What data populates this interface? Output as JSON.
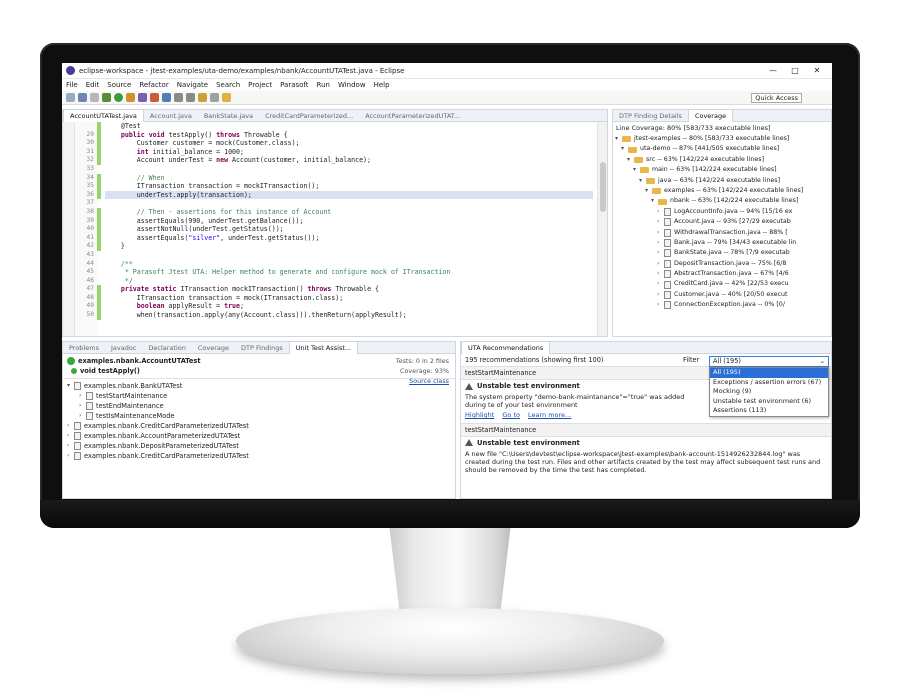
{
  "window": {
    "title": "eclipse-workspace - jtest-examples/uta-demo/examples/nbank/AccountUTATest.java - Eclipse",
    "minimize": "—",
    "maximize": "□",
    "close": "✕"
  },
  "menu": [
    "File",
    "Edit",
    "Source",
    "Refactor",
    "Navigate",
    "Search",
    "Project",
    "Parasoft",
    "Run",
    "Window",
    "Help"
  ],
  "toolbar": {
    "quick_access": "Quick Access"
  },
  "editor": {
    "tabs": [
      "AccountUTATest.java",
      "Account.java",
      "BankState.java",
      "CreditCardParameterized...",
      "AccountParameterizedUTAT..."
    ],
    "line_numbers": [
      "",
      "29",
      "30",
      "31",
      "32",
      "33",
      "34",
      "35",
      "36",
      "37",
      "38",
      "39",
      "40",
      "41",
      "42",
      "43",
      "44",
      "45",
      "46",
      "47",
      "48",
      "49",
      "50",
      "51"
    ],
    "lines": [
      "    @Test",
      "    public void testApply() throws Throwable {",
      "        Customer customer = mock(Customer.class);",
      "        int initial_balance = 1000;",
      "        Account underTest = new Account(customer, initial_balance);",
      "",
      "        // When",
      "        ITransaction transaction = mockITransaction();",
      "        underTest.apply(transaction);",
      "",
      "        // Then - assertions for this instance of Account",
      "        assertEquals(990, underTest.getBalance());",
      "        assertNotNull(underTest.getStatus());",
      "        assertEquals(\"silver\", underTest.getStatus());",
      "    }",
      "",
      "    /**",
      "     * Parasoft Jtest UTA: Helper method to generate and configure mock of ITransaction",
      "     */",
      "    private static ITransaction mockITransaction() throws Throwable {",
      "        ITransaction transaction = mock(ITransaction.class);",
      "        boolean applyResult = true;",
      "        when(transaction.apply(any(Account.class))).thenReturn(applyResult);"
    ]
  },
  "coverage": {
    "tabs": [
      "DTP Finding Details",
      "Coverage"
    ],
    "summary": "Line Coverage: 80% [583/733 executable lines]",
    "tree": [
      {
        "label": "jtest-examples -- 80% [583/733 executable lines]",
        "type": "folder",
        "level": 0
      },
      {
        "label": "uta-demo -- 87% [441/505 executable lines]",
        "type": "folder",
        "level": 1
      },
      {
        "label": "src -- 63% [142/224 executable lines]",
        "type": "folder",
        "level": 2
      },
      {
        "label": "main -- 63% [142/224 executable lines]",
        "type": "folder",
        "level": 3
      },
      {
        "label": "java -- 63% [142/224 executable lines]",
        "type": "folder",
        "level": 4
      },
      {
        "label": "examples -- 63% [142/224 executable lines]",
        "type": "folder",
        "level": 5
      },
      {
        "label": "nbank -- 63% [142/224 executable lines]",
        "type": "folder",
        "level": 6
      },
      {
        "label": "LogAccountInfo.java -- 94% [15/16 ex",
        "type": "file",
        "level": 7
      },
      {
        "label": "Account.java -- 93% [27/29 executab",
        "type": "file",
        "level": 7
      },
      {
        "label": "WithdrawalTransaction.java -- 88% [",
        "type": "file",
        "level": 7
      },
      {
        "label": "Bank.java -- 79% [34/43 executable lin",
        "type": "file",
        "level": 7
      },
      {
        "label": "BankState.java -- 78% [7/9 executab",
        "type": "file",
        "level": 7
      },
      {
        "label": "DepositTransaction.java -- 75% [6/8",
        "type": "file",
        "level": 7
      },
      {
        "label": "AbstractTransaction.java -- 67% [4/6",
        "type": "file",
        "level": 7
      },
      {
        "label": "CreditCard.java -- 42% [22/53 execu",
        "type": "file",
        "level": 7
      },
      {
        "label": "Customer.java -- 40% [20/50 execut",
        "type": "file",
        "level": 7
      },
      {
        "label": "ConnectionException.java -- 0% [0/",
        "type": "file",
        "level": 7
      }
    ]
  },
  "unit_test": {
    "tabs": [
      "Problems",
      "Javadoc",
      "Declaration",
      "Coverage",
      "DTP Findings",
      "Unit Test Assist..."
    ],
    "class_name": "examples.nbank.AccountUTATest",
    "test_name": "void testApply()",
    "tests": "Tests: 0 in 2 files",
    "coverage": "Coverage: 93%",
    "source_class": "Source class",
    "tree": [
      {
        "label": "examples.nbank.BankUTATest",
        "level": 0,
        "expanded": true
      },
      {
        "label": "testStartMaintenance",
        "level": 1
      },
      {
        "label": "testEndMaintenance",
        "level": 1
      },
      {
        "label": "testIsMaintenanceMode",
        "level": 1
      },
      {
        "label": "examples.nbank.CreditCardParameterizedUTATest",
        "level": 0
      },
      {
        "label": "examples.nbank.AccountParameterizedUTATest",
        "level": 0
      },
      {
        "label": "examples.nbank.DepositParameterizedUTATest",
        "level": 0
      },
      {
        "label": "examples.nbank.CreditCardParameterizedUTATest",
        "level": 0
      }
    ]
  },
  "uta": {
    "tab": "UTA Recommendations",
    "count": "195 recommendations (showing first 100)",
    "filter_label": "Filter",
    "filter_value": "All (195)",
    "filter_options": [
      "All (195)",
      "Exceptions / assertion errors (67)",
      "Mocking (9)",
      "Unstable test environment (6)",
      "Assertions (113)"
    ],
    "items": [
      {
        "test": "testStartMaintenance",
        "title": "Unstable test environment",
        "body": "The system property \"demo-bank-maintanance\"=\"true\" was added during te of your test environment",
        "actions": [
          "Highlight",
          "Go to",
          "Learn more..."
        ]
      },
      {
        "test": "testStartMaintenance",
        "title": "Unstable test environment",
        "body": "A new file \"C:\\Users\\devtest\\eclipse-workspace\\jtest-examples\\bank-account-1514926232844.log\" was created during the test run. Files and other artifacts created by the test may affect subsequent test runs and should be removed by the time the test has completed."
      }
    ]
  }
}
